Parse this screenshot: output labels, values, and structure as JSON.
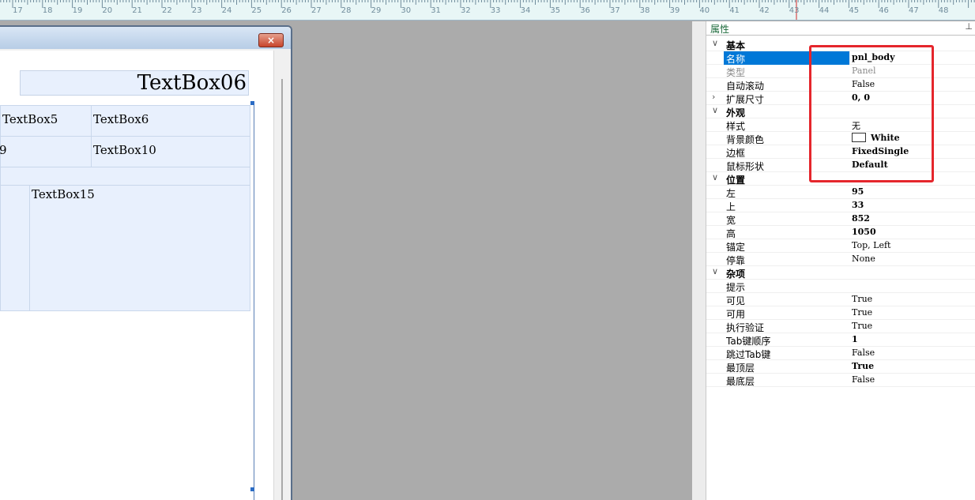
{
  "ruler": {
    "labels": [
      "17",
      "18",
      "19",
      "20",
      "21",
      "22",
      "23",
      "24",
      "25",
      "26",
      "27",
      "28",
      "29",
      "30",
      "31",
      "32",
      "33",
      "34",
      "35",
      "36",
      "37",
      "38",
      "39",
      "40",
      "41",
      "42",
      "43",
      "44",
      "45",
      "46",
      "47",
      "48"
    ]
  },
  "designer": {
    "close_glyph": "×",
    "header_textbox": "TextBox06",
    "cells": {
      "c1": "TextBox5",
      "c2": "TextBox6",
      "c3": "9",
      "c4": "TextBox10",
      "c5": "TextBox15"
    }
  },
  "properties": {
    "title": "属性",
    "pin_glyph": "⊥",
    "colors": {
      "selection": "#0078d7",
      "highlight": "#e5262c"
    },
    "categories": {
      "basic": "基本",
      "appearance": "外观",
      "position": "位置",
      "misc": "杂项"
    },
    "rows": {
      "name": {
        "label": "名称",
        "value": "pnl_body"
      },
      "type": {
        "label": "类型",
        "value": "Panel"
      },
      "autoscroll": {
        "label": "自动滚动",
        "value": "False"
      },
      "extent": {
        "label": "扩展尺寸",
        "value": "0, 0"
      },
      "style": {
        "label": "样式",
        "value": "无"
      },
      "backcolor": {
        "label": "背景颜色",
        "value": "White"
      },
      "border": {
        "label": "边框",
        "value": "FixedSingle"
      },
      "cursor": {
        "label": "鼠标形状",
        "value": "Default"
      },
      "left": {
        "label": "左",
        "value": "95"
      },
      "top": {
        "label": "上",
        "value": "33"
      },
      "width": {
        "label": "宽",
        "value": "852"
      },
      "height": {
        "label": "高",
        "value": "1050"
      },
      "anchor": {
        "label": "锚定",
        "value": "Top, Left"
      },
      "dock": {
        "label": "停靠",
        "value": "None"
      },
      "tooltip": {
        "label": "提示",
        "value": ""
      },
      "visible": {
        "label": "可见",
        "value": "True"
      },
      "enabled": {
        "label": "可用",
        "value": "True"
      },
      "validation": {
        "label": "执行验证",
        "value": "True"
      },
      "taborder": {
        "label": "Tab键顺序",
        "value": "1"
      },
      "tabstop": {
        "label": "跳过Tab键",
        "value": "False"
      },
      "topmost": {
        "label": "最顶层",
        "value": "True"
      },
      "bottommost": {
        "label": "最底层",
        "value": "False"
      }
    }
  }
}
